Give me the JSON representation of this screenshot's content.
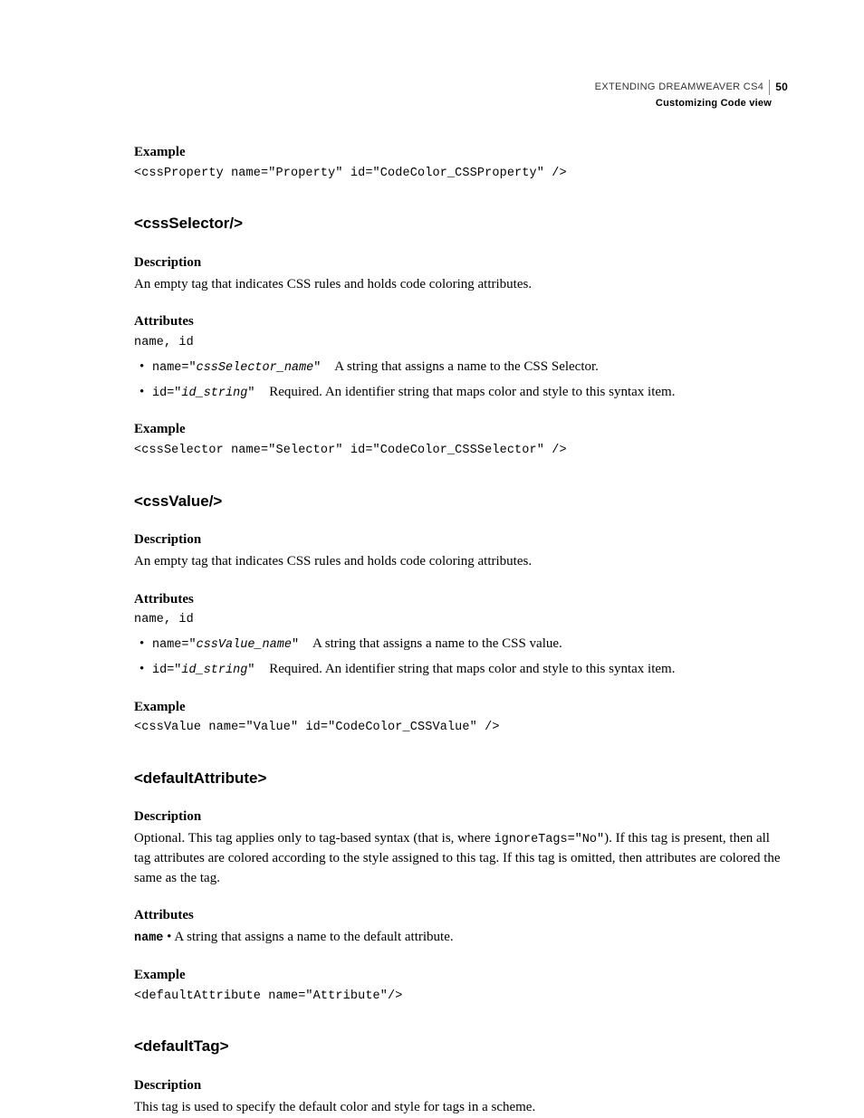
{
  "header": {
    "doc_title": "EXTENDING DREAMWEAVER CS4",
    "page_number": "50",
    "section_title": "Customizing Code view"
  },
  "intro": {
    "example_label": "Example",
    "example_code": "<cssProperty name=\"Property\" id=\"CodeColor_CSSProperty\" />"
  },
  "sections": [
    {
      "heading": "<cssSelector/>",
      "desc_label": "Description",
      "desc_text": "An empty tag that indicates CSS rules and holds code coloring attributes.",
      "attr_label": "Attributes",
      "attr_list_code": "name, id",
      "bullets": [
        {
          "code_prefix": "name=\"",
          "code_italic": "cssSelector_name",
          "code_suffix": "\"",
          "text": "A string that assigns a name to the CSS Selector."
        },
        {
          "code_prefix": "id=\"",
          "code_italic": "id_string",
          "code_suffix": "\"",
          "text": "Required. An identifier string that maps color and style to this syntax item."
        }
      ],
      "example_label": "Example",
      "example_code": "<cssSelector name=\"Selector\" id=\"CodeColor_CSSSelector\" />"
    },
    {
      "heading": "<cssValue/>",
      "desc_label": "Description",
      "desc_text": "An empty tag that indicates CSS rules and holds code coloring attributes.",
      "attr_label": "Attributes",
      "attr_list_code": "name, id",
      "bullets": [
        {
          "code_prefix": "name=\"",
          "code_italic": "cssValue_name",
          "code_suffix": "\"",
          "text": "A string that assigns a name to the CSS value."
        },
        {
          "code_prefix": "id=\"",
          "code_italic": "id_string",
          "code_suffix": "\"",
          "text": "Required. An identifier string that maps color and style to this syntax item."
        }
      ],
      "example_label": "Example",
      "example_code": "<cssValue name=\"Value\" id=\"CodeColor_CSSValue\" />"
    }
  ],
  "defaultAttribute": {
    "heading": "<defaultAttribute>",
    "desc_label": "Description",
    "desc_text_before": "Optional. This tag applies only to tag-based syntax (that is, where ",
    "desc_code": "ignoreTags=\"No\"",
    "desc_text_after": "). If this tag is present, then all tag attributes are colored according to the style assigned to this tag. If this tag is omitted, then attributes are colored the same as the tag.",
    "attr_label": "Attributes",
    "attr_name_code": "name",
    "attr_bullet": " •",
    "attr_text": "A string that assigns a name to the default attribute.",
    "example_label": "Example",
    "example_code": "<defaultAttribute name=\"Attribute\"/>"
  },
  "defaultTag": {
    "heading": "<defaultTag>",
    "desc_label": "Description",
    "desc_text": "This tag is used to specify the default color and style for tags in a scheme."
  }
}
